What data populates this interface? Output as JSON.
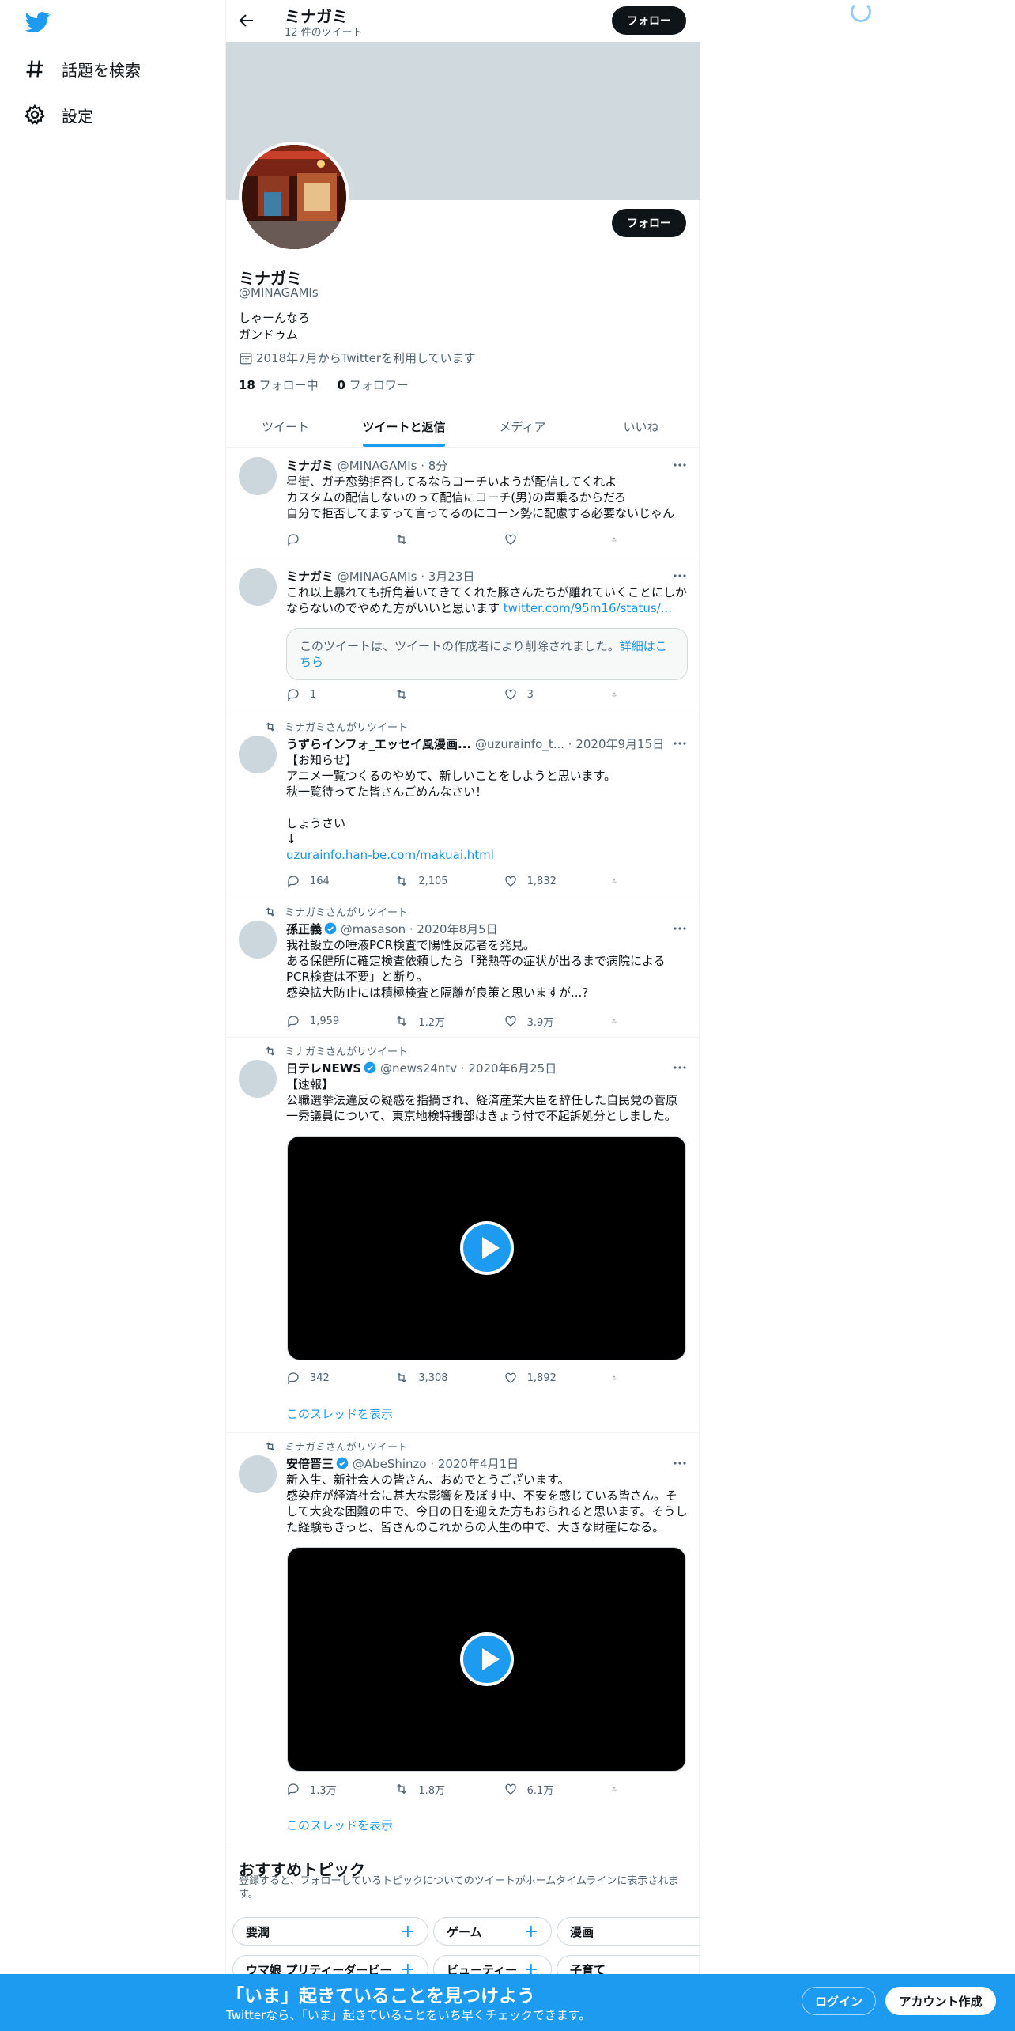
{
  "sidebar": {
    "items": [
      {
        "label": "話題を検索",
        "icon": "hashtag-icon"
      },
      {
        "label": "設定",
        "icon": "gear-icon"
      }
    ]
  },
  "header": {
    "name": "ミナガミ",
    "tweet_count": "12 件のツイート",
    "follow_label": "フォロー"
  },
  "profile": {
    "follow_label": "フォロー",
    "name": "ミナガミ",
    "handle": "@MINAGAMIs",
    "bio_line1": "しゃーんなろ",
    "bio_line2": "ガンドゥム",
    "joined": "2018年7月からTwitterを利用しています",
    "following_count": "18",
    "following_label": "フォロー中",
    "followers_count": "0",
    "followers_label": "フォロワー"
  },
  "tabs": [
    "ツイート",
    "ツイートと返信",
    "メディア",
    "いいね"
  ],
  "tweets": [
    {
      "name": "ミナガミ",
      "handle": "@MINAGAMIs",
      "time": "8分",
      "text": "星街、ガチ恋勢拒否してるならコーチいようが配信してくれよ\nカスタムの配信しないのって配信にコーチ(男)の声乗るからだろ\n自分で拒否してますって言ってるのにコーン勢に配慮する必要ないじゃん",
      "replies": "",
      "retweets": "",
      "likes": ""
    },
    {
      "name": "ミナガミ",
      "handle": "@MINAGAMIs",
      "time": "3月23日",
      "text": "これ以上暴れても折角着いてきてくれた豚さんたちが離れていくことにしかならないのでやめた方がいいと思います ",
      "link": "twitter.com/95m16/status/...",
      "quote": "このツイートは、ツイートの作成者により削除されました。",
      "quote_link": "詳細はこちら",
      "replies": "1",
      "retweets": "",
      "likes": "3"
    },
    {
      "rt_label": "ミナガミさんがリツイート",
      "name": "うずらインフォ_エッセイ風漫画...",
      "handle": "@uzurainfo_t...",
      "time": "2020年9月15日",
      "text": "【お知らせ】\nアニメ一覧つくるのやめて、新しいことをしようと思います。\n秋一覧待ってた皆さんごめんなさい！\n\nしょうさい\n↓",
      "link": "uzurainfo.han-be.com/makuai.html",
      "replies": "164",
      "retweets": "2,105",
      "likes": "1,832"
    },
    {
      "rt_label": "ミナガミさんがリツイート",
      "name": "孫正義",
      "handle": "@masason",
      "time": "2020年8月5日",
      "text": "我社設立の唾液PCR検査で陽性反応者を発見。\nある保健所に確定検査依頼したら「発熱等の症状が出るまで病院によるPCR検査は不要」と断り。\n感染拡大防止には積極検査と隔離が良策と思いますが...?",
      "replies": "1,959",
      "retweets": "1.2万",
      "likes": "3.9万"
    },
    {
      "rt_label": "ミナガミさんがリツイート",
      "name": "日テレNEWS",
      "handle": "@news24ntv",
      "time": "2020年6月25日",
      "text": "【速報】\n公職選挙法違反の疑惑を指摘され、経済産業大臣を辞任した自民党の菅原一秀議員について、東京地検特捜部はきょう付で不起訴処分としました。",
      "replies": "342",
      "retweets": "3,308",
      "likes": "1,892",
      "thread": "このスレッドを表示"
    },
    {
      "rt_label": "ミナガミさんがリツイート",
      "name": "安倍晋三",
      "handle": "@AbeShinzo",
      "time": "2020年4月1日",
      "text": "新入生、新社会人の皆さん、おめでとうございます。\n感染症が経済社会に甚大な影響を及ぼす中、不安を感じている皆さん。そして大変な困難の中で、今日の日を迎えた方もおられると思います。そうした経験もきっと、皆さんのこれからの人生の中で、大きな財産になる。",
      "replies": "1.3万",
      "retweets": "1.8万",
      "likes": "6.1万",
      "thread": "このスレッドを表示"
    }
  ],
  "topics": {
    "title": "おすすめトピック",
    "subtitle": "登録すると、フォローしているトピックについてのツイートがホームタイムラインに表示されます。",
    "chips": [
      "要潤",
      "ゲーム",
      "漫画",
      "ウマ娘 プリティーダービー",
      "ビューティー",
      "子育て"
    ]
  },
  "bottom_bar": {
    "title": "「いま」起きていることを見つけよう",
    "subtitle": "Twitterなら、「いま」起きていることをいち早くチェックできます。",
    "login": "ログイン",
    "signup": "アカウント作成"
  },
  "colors": {
    "accent": "#1d9bf0",
    "dark": "#0f1419",
    "muted": "#536471",
    "banner": "#cfd9de"
  }
}
